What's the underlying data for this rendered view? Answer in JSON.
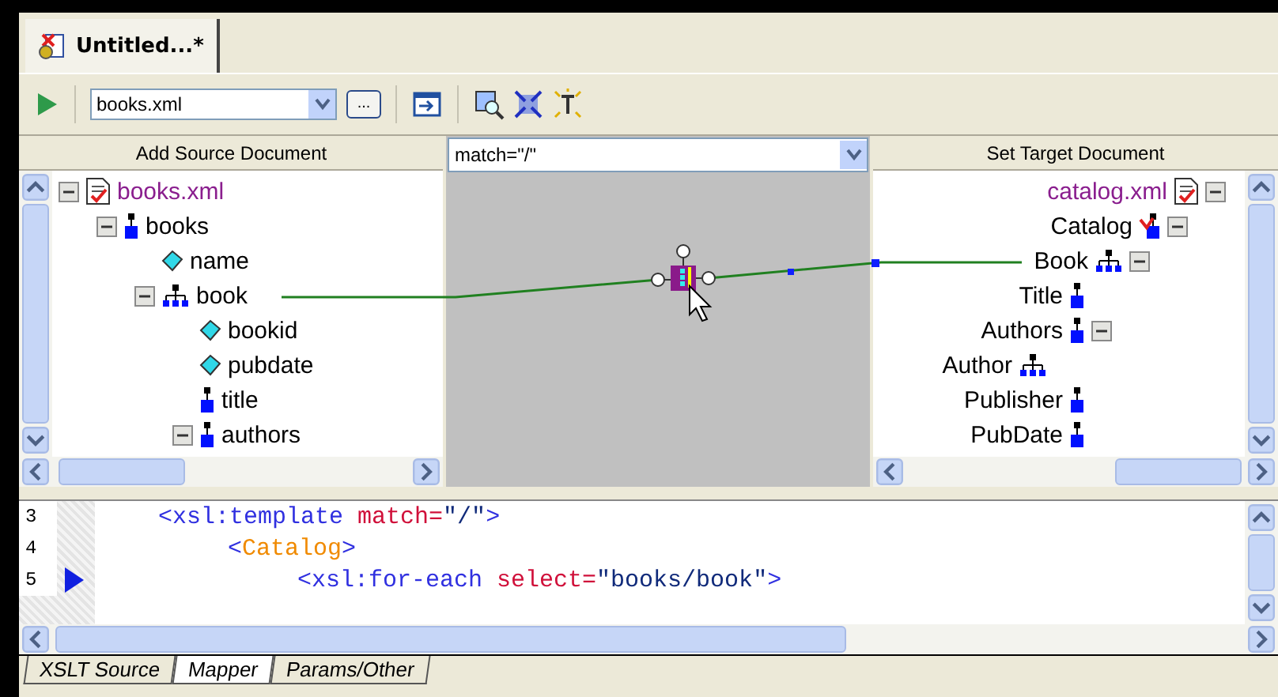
{
  "document_tab": {
    "title": "Untitled...*",
    "selected": true
  },
  "toolbar": {
    "source_combo": {
      "value": "books.xml"
    },
    "browse_button": "..."
  },
  "source_panel": {
    "header": "Add Source Document",
    "tree": [
      {
        "label": "books.xml",
        "kind": "document",
        "expanded": true,
        "children": [
          {
            "label": "books",
            "kind": "element",
            "expanded": true,
            "children": [
              {
                "label": "name",
                "kind": "attribute"
              },
              {
                "label": "book",
                "kind": "repeating",
                "expanded": true,
                "children": [
                  {
                    "label": "bookid",
                    "kind": "attribute"
                  },
                  {
                    "label": "pubdate",
                    "kind": "attribute"
                  },
                  {
                    "label": "title",
                    "kind": "element"
                  },
                  {
                    "label": "authors",
                    "kind": "element",
                    "expanded": true
                  }
                ]
              }
            ]
          }
        ]
      }
    ]
  },
  "mapper": {
    "match_combo": {
      "value": "match=\"/\""
    }
  },
  "target_panel": {
    "header": "Set Target Document",
    "tree": [
      {
        "label": "catalog.xml",
        "kind": "document",
        "expanded": true,
        "children": [
          {
            "label": "Catalog",
            "kind": "root",
            "expanded": true,
            "children": [
              {
                "label": "Book",
                "kind": "repeating",
                "expanded": true,
                "children": [
                  {
                    "label": "Title",
                    "kind": "element"
                  },
                  {
                    "label": "Authors",
                    "kind": "element",
                    "expanded": true,
                    "children": [
                      {
                        "label": "Author",
                        "kind": "repeating"
                      }
                    ]
                  },
                  {
                    "label": "Publisher",
                    "kind": "element"
                  },
                  {
                    "label": "PubDate",
                    "kind": "element"
                  }
                ]
              }
            ]
          }
        ]
      }
    ]
  },
  "code": {
    "lines": [
      {
        "number": "3",
        "current": false,
        "tokens": [
          {
            "kind": "tag",
            "text": "<xsl:template"
          },
          {
            "kind": "attr",
            "text": " match="
          },
          {
            "kind": "value",
            "text": "\"/\""
          },
          {
            "kind": "tag",
            "text": ">"
          }
        ],
        "children": [
          {
            "number": "4",
            "current": false,
            "tokens": [
              {
                "kind": "tag",
                "text": "<"
              },
              {
                "kind": "literal",
                "text": "Catalog"
              },
              {
                "kind": "tag",
                "text": ">"
              }
            ],
            "children": [
              {
                "number": "5",
                "current": true,
                "tokens": [
                  {
                    "kind": "tag",
                    "text": "<xsl:for-each"
                  },
                  {
                    "kind": "attr",
                    "text": " select="
                  },
                  {
                    "kind": "value",
                    "text": "\"books/book\""
                  },
                  {
                    "kind": "tag",
                    "text": ">"
                  }
                ]
              }
            ]
          }
        ]
      }
    ]
  },
  "bottom_tabs": [
    {
      "label": "XSLT Source",
      "selected": false
    },
    {
      "label": "Mapper",
      "selected": true
    },
    {
      "label": "Params/Other",
      "selected": false
    }
  ]
}
